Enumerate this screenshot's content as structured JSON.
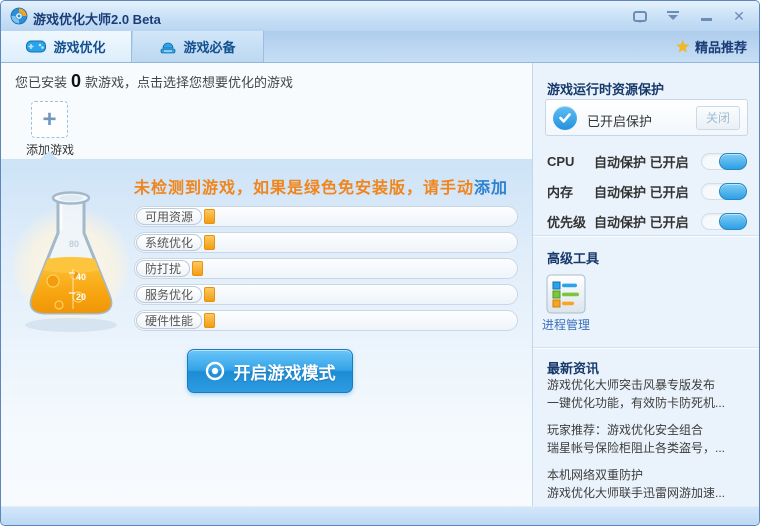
{
  "window": {
    "title": "游戏优化大师2.0 Beta"
  },
  "tabs": [
    {
      "label": "游戏优化"
    },
    {
      "label": "游戏必备"
    }
  ],
  "premium": {
    "label": "精品推荐"
  },
  "main": {
    "installed": {
      "prefix": "您已安装",
      "count": "0",
      "suffix": "款游戏，点击选择您想要优化的游戏"
    },
    "add_game_label": "添加游戏",
    "notice_text": "未检测到游戏，如果是绿色免安装版，请手动",
    "notice_link": "添加",
    "meters": [
      "可用资源",
      "系统优化",
      "防打扰",
      "服务优化",
      "硬件性能"
    ],
    "start_button_label": "开启游戏模式"
  },
  "sidebar": {
    "protection": {
      "title": "游戏运行时资源保护",
      "status_text": "已开启保护",
      "close_button_label": "关闭",
      "toggles": [
        {
          "name": "CPU",
          "status": "自动保护 已开启",
          "state": "on"
        },
        {
          "name": "内存",
          "status": "自动保护 已开启",
          "state": "on"
        },
        {
          "name": "优先级",
          "status": "自动保护 已开启",
          "state": "on"
        }
      ]
    },
    "advanced": {
      "title": "高级工具",
      "tool_label": "进程管理"
    },
    "news": {
      "title": "最新资讯",
      "items": [
        {
          "line1": "游戏优化大师突击风暴专版发布",
          "line2": "一键优化功能，有效防卡防死机..."
        },
        {
          "line1": "玩家推荐：游戏优化安全组合",
          "line2": "瑞星帐号保险柜阻止各类盗号，..."
        },
        {
          "line1": "本机网络双重防护",
          "line2": "游戏优化大师联手迅雷网游加速..."
        }
      ]
    }
  },
  "colors": {
    "accent_blue": "#2b9fe0",
    "headline_orange": "#f0851c",
    "link_blue": "#2f81d0",
    "heading_navy": "#16386b",
    "meter_orange": "#f5a623",
    "star_gold": "#f7b718"
  }
}
